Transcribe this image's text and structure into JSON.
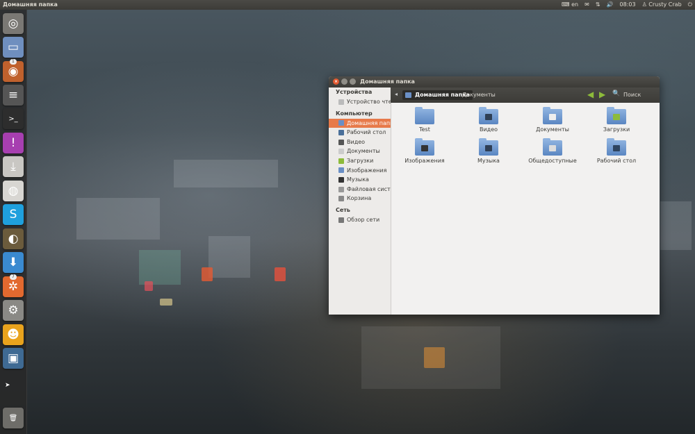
{
  "top_panel": {
    "title": "Домашняя папка",
    "lang": "en",
    "time": "08:03",
    "user": "Crusty Crab"
  },
  "launcher": {
    "items": [
      {
        "name": "dash-icon",
        "glyph": "◎",
        "bg": "#7a7874"
      },
      {
        "name": "files-icon",
        "glyph": "▭",
        "bg": "#6f8fbf"
      },
      {
        "name": "firefox-icon",
        "glyph": "◉",
        "bg": "#c0612d",
        "badge": "1"
      },
      {
        "name": "text-editor-icon",
        "glyph": "≡",
        "bg": "#555"
      },
      {
        "name": "terminal-icon",
        "glyph": ">_",
        "bg": "#2d2d2d"
      },
      {
        "name": "notifications-icon",
        "glyph": "!",
        "bg": "#a73fb0"
      },
      {
        "name": "install-icon",
        "glyph": "⤓",
        "bg": "#c9c7c3"
      },
      {
        "name": "speaker-icon",
        "glyph": "◍",
        "bg": "#d8d6d2"
      },
      {
        "name": "skype-icon",
        "glyph": "S",
        "bg": "#1fa0dd"
      },
      {
        "name": "gimp-icon",
        "glyph": "◐",
        "bg": "#6b5b3c"
      },
      {
        "name": "download-icon",
        "glyph": "⬇",
        "bg": "#3a8ad0"
      },
      {
        "name": "update-manager-icon",
        "glyph": "✲",
        "bg": "#e2692f",
        "badge": "7"
      },
      {
        "name": "settings-icon",
        "glyph": "⚙",
        "bg": "#8a8985"
      },
      {
        "name": "pidgin-icon",
        "glyph": "☻",
        "bg": "#e9a31d"
      },
      {
        "name": "workspace-switcher-icon",
        "glyph": "▣",
        "bg": "#3f6a93"
      },
      {
        "name": "trash-icon",
        "glyph": "🗑",
        "bg": "#6e6d69"
      }
    ]
  },
  "window": {
    "title": "Домашняя папка",
    "breadcrumb_active": "Домашняя папка",
    "breadcrumb_next": "Документы",
    "search_label": "Поиск"
  },
  "sidebar": {
    "sections": [
      {
        "heading": "Устройства",
        "items": [
          {
            "label": "Устройство чте...",
            "icon": "drive-icon",
            "color": "#bbb"
          }
        ]
      },
      {
        "heading": "Компьютер",
        "items": [
          {
            "label": "Домашняя папка",
            "icon": "home-icon",
            "color": "#6a8fc6",
            "active": true
          },
          {
            "label": "Рабочий стол",
            "icon": "desktop-icon",
            "color": "#4a6f99"
          },
          {
            "label": "Видео",
            "icon": "video-icon",
            "color": "#555"
          },
          {
            "label": "Документы",
            "icon": "documents-icon",
            "color": "#ccc"
          },
          {
            "label": "Загрузки",
            "icon": "downloads-icon",
            "color": "#8dbb3a"
          },
          {
            "label": "Изображения",
            "icon": "pictures-icon",
            "color": "#6a8fc6"
          },
          {
            "label": "Музыка",
            "icon": "music-icon",
            "color": "#333"
          },
          {
            "label": "Файловая сист...",
            "icon": "filesystem-icon",
            "color": "#999"
          },
          {
            "label": "Корзина",
            "icon": "trash-icon",
            "color": "#888"
          }
        ]
      },
      {
        "heading": "Сеть",
        "items": [
          {
            "label": "Обзор сети",
            "icon": "network-icon",
            "color": "#777"
          }
        ]
      }
    ]
  },
  "files": [
    {
      "label": "Test",
      "icon": "folder-icon",
      "emblem": ""
    },
    {
      "label": "Видео",
      "icon": "video-folder-icon",
      "emblem": "#2f3f55"
    },
    {
      "label": "Документы",
      "icon": "documents-folder-icon",
      "emblem": "#eeeeee"
    },
    {
      "label": "Загрузки",
      "icon": "downloads-folder-icon",
      "emblem": "#8dbb3a"
    },
    {
      "label": "Изображения",
      "icon": "pictures-folder-icon",
      "emblem": "#333"
    },
    {
      "label": "Музыка",
      "icon": "music-folder-icon",
      "emblem": "#2f3f55"
    },
    {
      "label": "Общедоступные",
      "icon": "public-folder-icon",
      "emblem": "#dddddd"
    },
    {
      "label": "Рабочий стол",
      "icon": "desktop-folder-icon",
      "emblem": "#2f4560"
    }
  ]
}
